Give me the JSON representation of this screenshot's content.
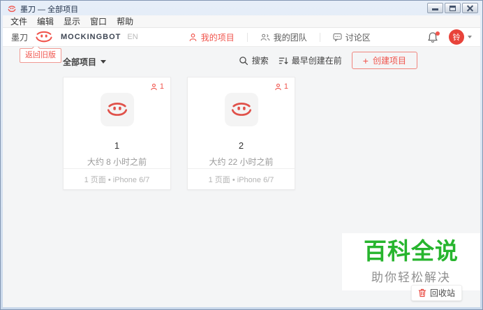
{
  "window": {
    "title": "墨刀 — 全部项目"
  },
  "menubar": {
    "items": [
      "文件",
      "编辑",
      "显示",
      "窗口",
      "帮助"
    ]
  },
  "header": {
    "brand_cn": "墨刀",
    "brand_en": "MOCKINGBOT",
    "lang": "EN",
    "tabs": [
      {
        "label": "我的项目",
        "active": true
      },
      {
        "label": "我的团队",
        "active": false
      },
      {
        "label": "讨论区",
        "active": false
      }
    ],
    "avatar_text": "铃"
  },
  "toolbar": {
    "back_to_old_label": "返回旧版",
    "filter_label": "全部项目",
    "search_label": "搜索",
    "sort_label": "最早创建在前",
    "create_plus": "+",
    "create_label": "创建项目"
  },
  "projects": [
    {
      "name": "1",
      "time": "大约 8 小时之前",
      "members": "1",
      "meta": "1 页面 • iPhone 6/7"
    },
    {
      "name": "2",
      "time": "大约 22 小时之前",
      "members": "1",
      "meta": "1 页面 • iPhone 6/7"
    }
  ],
  "watermark": {
    "title": "百科全说",
    "subtitle": "助你轻松解决"
  },
  "recycle": {
    "label": "回收站"
  },
  "colors": {
    "accent": "#f0544c",
    "avatar": "#e8433a",
    "green": "#27b52e"
  }
}
